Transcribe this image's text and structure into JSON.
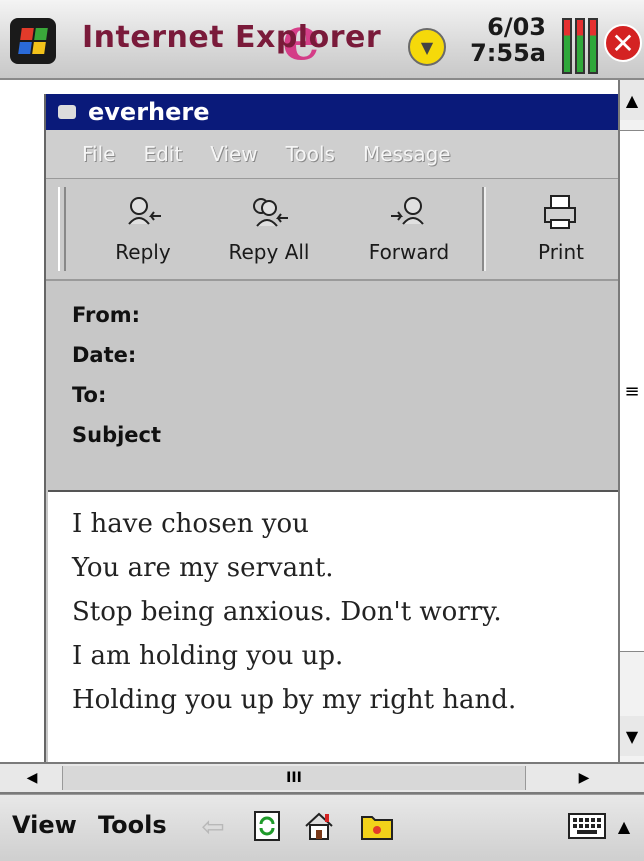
{
  "titlebar": {
    "app_title": "Internet Explorer",
    "date": "6/03",
    "time": "7:55a",
    "close_label": "✕",
    "notify_glyph": "▼"
  },
  "email": {
    "window_title": "everhere",
    "menu": [
      "File",
      "Edit",
      "View",
      "Tools",
      "Message"
    ],
    "toolbar": [
      {
        "label": "Reply",
        "icon": "reply-icon"
      },
      {
        "label": "Repy All",
        "icon": "reply-all-icon"
      },
      {
        "label": "Forward",
        "icon": "forward-icon"
      },
      {
        "label": "Print",
        "icon": "print-icon"
      }
    ],
    "headers": {
      "from": "From:",
      "date": "Date:",
      "to": "To:",
      "subject": "Subject"
    },
    "body_lines": [
      "I have chosen you",
      "You are my servant.",
      "Stop being anxious. Don't worry.",
      "I am holding you up.",
      "Holding you up by my right hand."
    ]
  },
  "scrollbars": {
    "up": "▲",
    "down": "▼",
    "left": "◀",
    "right": "▶",
    "v_grip": "≡",
    "h_grip": "III"
  },
  "bottom": {
    "view_label": "View",
    "tools_label": "Tools",
    "back_glyph": "⇦",
    "sip_up": "▲"
  },
  "colors": {
    "title_text": "#7a1a3a",
    "email_title_bg": "#0a1a7a",
    "close_red": "#d42222"
  }
}
